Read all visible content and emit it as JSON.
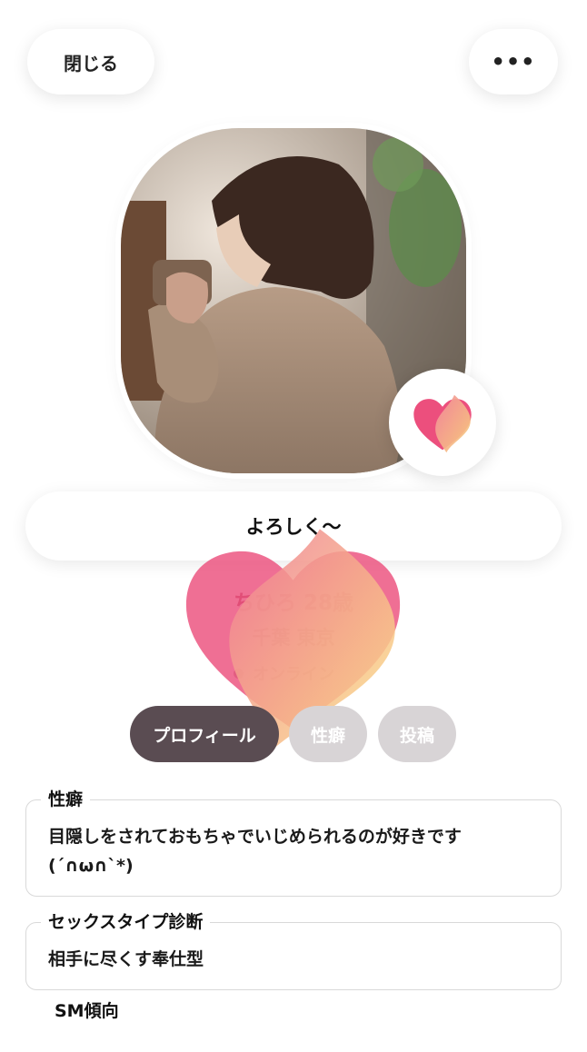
{
  "header": {
    "close_label": "閉じる",
    "more_label": "•••"
  },
  "profile": {
    "greeting": "よろしく〜",
    "name_age": "ちひろ 28歳",
    "location": "千葉 東京",
    "status": "オンライン"
  },
  "tabs": [
    {
      "label": "プロフィール",
      "active": true
    },
    {
      "label": "性癖",
      "active": false
    },
    {
      "label": "投稿",
      "active": false
    }
  ],
  "fields": [
    {
      "label": "性癖",
      "value_line1": "目隠しをされておもちゃでいじめられるのが好きです",
      "value_line2": "(´∩ω∩`*)"
    },
    {
      "label": "セックスタイプ診断",
      "value": "相手に尽くす奉仕型"
    },
    {
      "label": "SM傾向"
    }
  ],
  "colors": {
    "accent": "#e94a78",
    "tab_active": "#5a4c52",
    "tab_inactive": "#d8d4d6"
  },
  "icons": {
    "logo": "heart-flame-logo-icon"
  }
}
